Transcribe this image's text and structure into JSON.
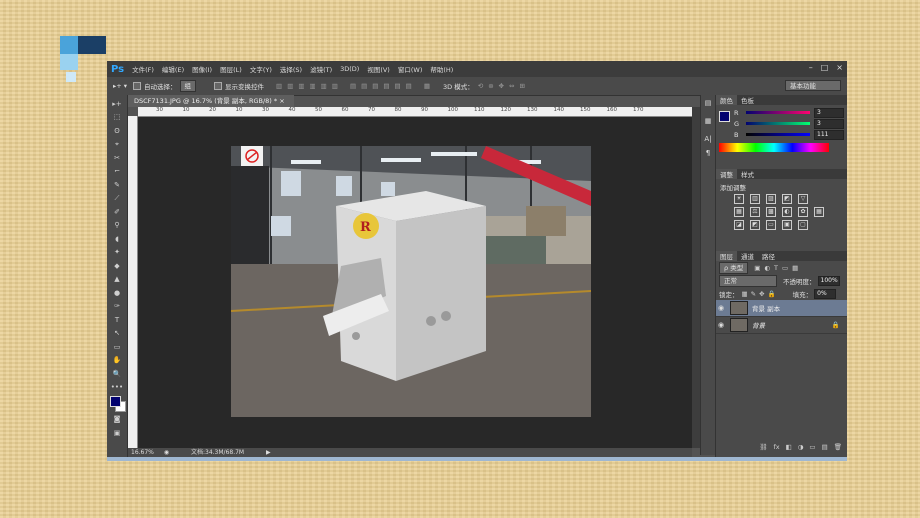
{
  "menu": {
    "app_logo": "Ps",
    "items": [
      "文件(F)",
      "编辑(E)",
      "图像(I)",
      "图层(L)",
      "文字(Y)",
      "选择(S)",
      "滤镜(T)",
      "3D(D)",
      "视图(V)",
      "窗口(W)",
      "帮助(H)"
    ],
    "window_buttons": [
      "–",
      "□",
      "×"
    ]
  },
  "options": {
    "auto_select_label": "自动选择：",
    "auto_select_value": "组",
    "show_transform_label": "显示变换控件",
    "mode_3d_label": "3D 模式：",
    "workspace": "基本功能"
  },
  "document": {
    "tab_title": "DSCF7131.JPG @ 16.7% (背景 副本, RGB/8) *  ×",
    "zoom": "16.67%",
    "doc_size": "文档:34.3M/68.7M",
    "ruler_ticks": [
      "30",
      "10",
      "20",
      "10",
      "30",
      "40",
      "50",
      "60",
      "70",
      "80",
      "90",
      "100",
      "110",
      "120",
      "130",
      "140",
      "150",
      "160",
      "170"
    ]
  },
  "tools": [
    "▸+",
    "⬚",
    "ʘ",
    "⌖",
    "✂",
    "⌐",
    "✎",
    "⟋",
    "✐",
    "⚲",
    "◖",
    "✦",
    "◆",
    "▲",
    "●",
    "✑",
    "T",
    "↖",
    "▭",
    "✋",
    "🔍",
    "•••"
  ],
  "color_panel": {
    "tabs": [
      "颜色",
      "色板"
    ],
    "r_label": "R",
    "r_value": "3",
    "g_label": "G",
    "g_value": "3",
    "b_label": "B",
    "b_value": "111",
    "fg_color": "#030370",
    "bg_color": "#ffffff"
  },
  "adjustments_panel": {
    "tabs": [
      "调整",
      "样式"
    ],
    "heading": "添加调整",
    "row1": [
      "☀",
      "▥",
      "▨",
      "◩",
      "▽"
    ],
    "row2": [
      "▦",
      "⚖",
      "▩",
      "◐",
      "✿",
      "▦"
    ],
    "row3": [
      "◪",
      "◩",
      "▭",
      "▣",
      "▢"
    ]
  },
  "layers_panel": {
    "tabs": [
      "图层",
      "通道",
      "路径"
    ],
    "filter_kind": "ρ 类型",
    "blend_mode": "正常",
    "opacity_label": "不透明度：",
    "opacity_value": "100%",
    "lock_label": "锁定：",
    "fill_label": "填充：",
    "fill_value": "0%",
    "layers": [
      {
        "name": "背景 副本",
        "selected": true,
        "locked": false
      },
      {
        "name": "背景",
        "selected": false,
        "locked": true
      }
    ],
    "footer_icons": [
      "⛓",
      "fx",
      "◧",
      "◑",
      "▭",
      "▤",
      "🗑"
    ]
  },
  "photo": {
    "sign_text": "R"
  }
}
